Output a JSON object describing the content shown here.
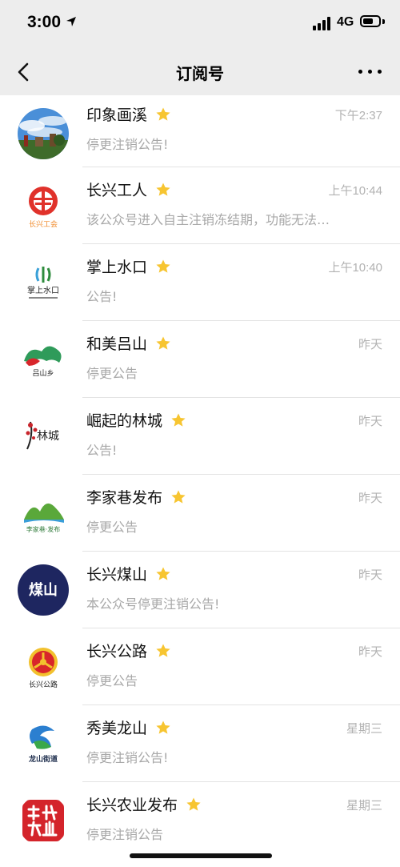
{
  "status_bar": {
    "time": "3:00",
    "network": "4G"
  },
  "nav": {
    "title": "订阅号"
  },
  "accounts": [
    {
      "name": "印象画溪",
      "time": "下午2:37",
      "summary": "停更注销公告!",
      "avatar_icon": "landscape-photo-icon"
    },
    {
      "name": "长兴工人",
      "time": "上午10:44",
      "summary": "该公众号进入自主注销冻结期，功能无法…",
      "avatar_icon": "labor-union-logo-icon",
      "avatar_text": "长兴工会"
    },
    {
      "name": "掌上水口",
      "time": "上午10:40",
      "summary": "公告!",
      "avatar_icon": "shuikou-logo-icon",
      "avatar_text": "掌上水口"
    },
    {
      "name": "和美吕山",
      "time": "昨天",
      "summary": "停更公告",
      "avatar_icon": "lushan-logo-icon",
      "avatar_text": "吕山乡"
    },
    {
      "name": "崛起的林城",
      "time": "昨天",
      "summary": "公告!",
      "avatar_icon": "lincheng-logo-icon",
      "avatar_text": "林城"
    },
    {
      "name": "李家巷发布",
      "time": "昨天",
      "summary": "停更公告",
      "avatar_icon": "lijiaxiang-logo-icon",
      "avatar_text": "李家巷·发布"
    },
    {
      "name": "长兴煤山",
      "time": "昨天",
      "summary": "本公众号停更注销公告!",
      "avatar_icon": "meishan-logo-icon",
      "avatar_text": "煤山"
    },
    {
      "name": "长兴公路",
      "time": "昨天",
      "summary": "停更公告",
      "avatar_icon": "highway-logo-icon",
      "avatar_text": "长兴公路"
    },
    {
      "name": "秀美龙山",
      "time": "星期三",
      "summary": "停更注销公告!",
      "avatar_icon": "longshan-logo-icon",
      "avatar_text": "龙山街道"
    },
    {
      "name": "长兴农业发布",
      "time": "星期三",
      "summary": "停更注销公告",
      "avatar_icon": "agriculture-seal-icon"
    }
  ],
  "colors": {
    "star": "#f7c531",
    "muted_text": "#a8a8a8",
    "bar_bg": "#ededed"
  }
}
